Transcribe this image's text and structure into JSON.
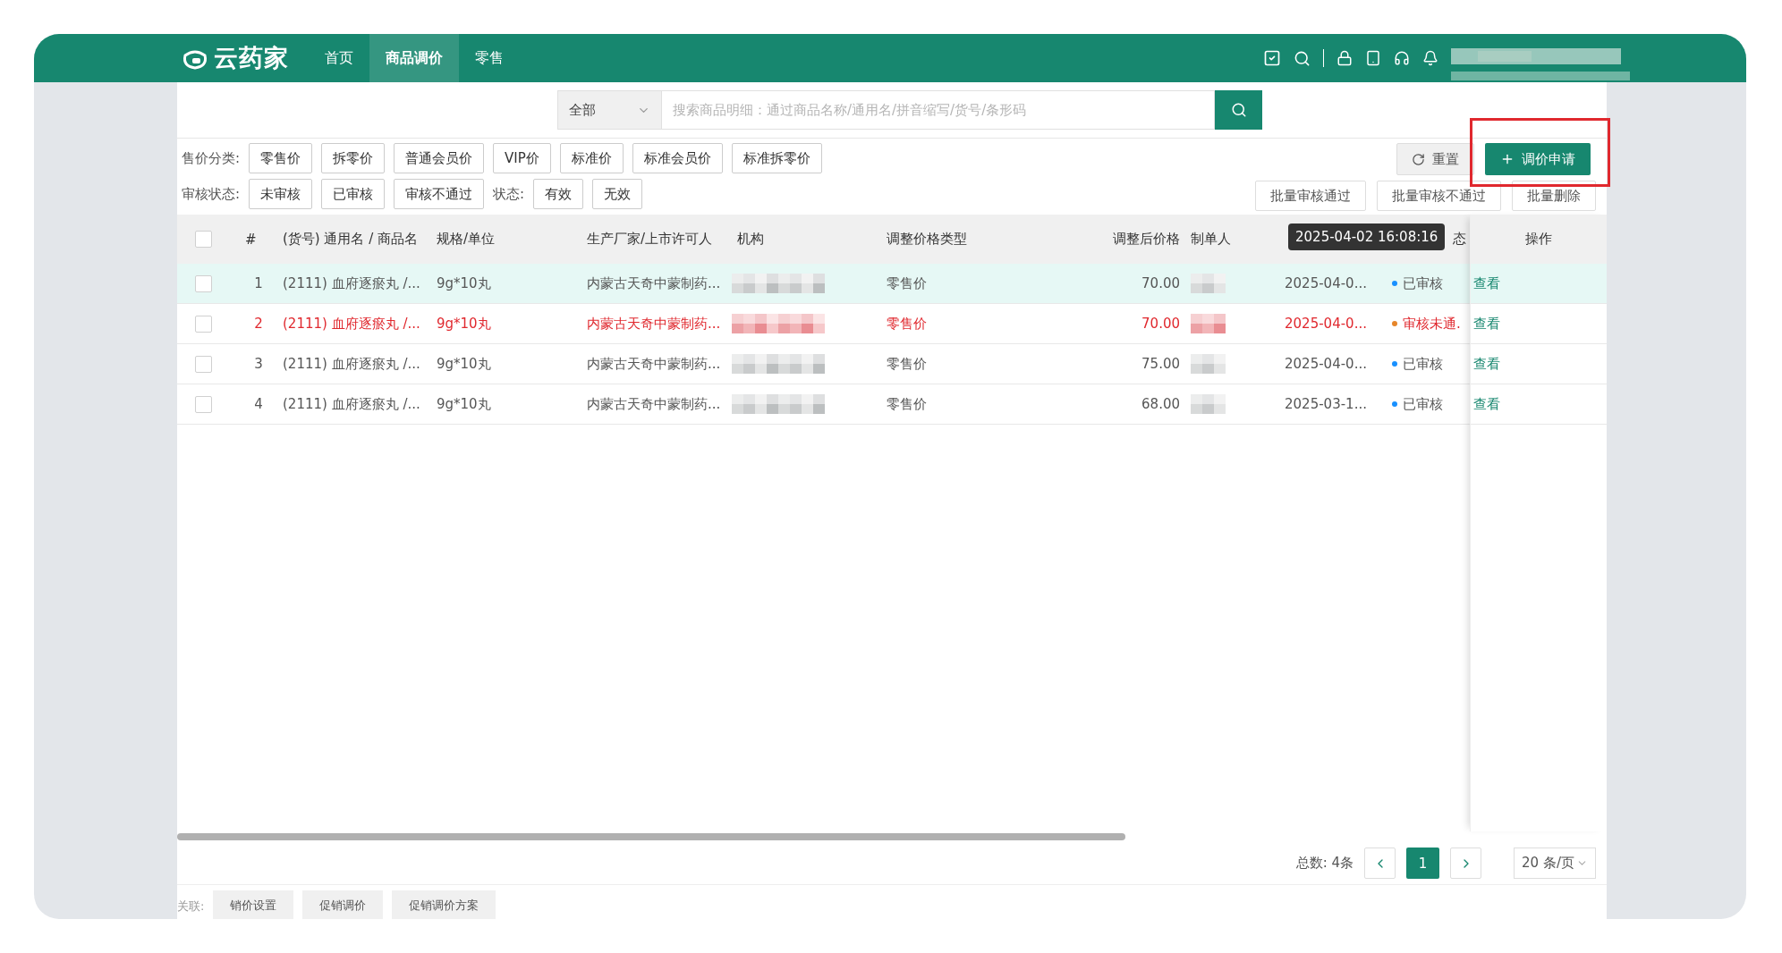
{
  "header": {
    "logo": "云药家",
    "nav": [
      {
        "label": "首页",
        "selected": false
      },
      {
        "label": "商品调价",
        "selected": true
      },
      {
        "label": "零售",
        "selected": false
      }
    ]
  },
  "search": {
    "category": "全部",
    "placeholder": "搜索商品明细：通过商品名称/通用名/拼音缩写/货号/条形码"
  },
  "filters": {
    "price_label": "售价分类:",
    "price_types": [
      "零售价",
      "拆零价",
      "普通会员价",
      "VIP价",
      "标准价",
      "标准会员价",
      "标准拆零价"
    ],
    "audit_label": "审核状态:",
    "audit_states": [
      "未审核",
      "已审核",
      "审核不通过"
    ],
    "state_label": "状态:",
    "states": [
      "有效",
      "无效"
    ]
  },
  "actions": {
    "reset": "重置",
    "apply": "调价申请",
    "apply_highlighted": true,
    "bulk": [
      "批量审核通过",
      "批量审核不通过",
      "批量删除"
    ]
  },
  "table": {
    "select_all": {
      "checked": false
    },
    "columns": [
      "#",
      "(货号) 通用名 / 商品名",
      "规格/单位",
      "生产厂家/上市许可人",
      "机构",
      "调整价格类型",
      "调整后价格",
      "制单人",
      "态",
      "操作"
    ],
    "tooltip": "2025-04-02 16:08:16",
    "rows": [
      {
        "index": "1",
        "name": "(2111) 血府逐瘀丸 /...",
        "spec": "9g*10丸",
        "mfr": "内蒙古天奇中蒙制药...",
        "type": "零售价",
        "price": "70.00",
        "date": "2025-04-0...",
        "status": "已审核",
        "kind": "approved",
        "color": "#1890ff",
        "highlighted": true,
        "checked": false,
        "action": "查看"
      },
      {
        "index": "2",
        "name": "(2111) 血府逐瘀丸 /...",
        "spec": "9g*10丸",
        "mfr": "内蒙古天奇中蒙制药...",
        "type": "零售价",
        "price": "70.00",
        "date": "2025-04-0...",
        "status": "审核未通.",
        "kind": "rejected",
        "color": "#e6862a",
        "highlighted": false,
        "checked": false,
        "action": "查看"
      },
      {
        "index": "3",
        "name": "(2111) 血府逐瘀丸 /...",
        "spec": "9g*10丸",
        "mfr": "内蒙古天奇中蒙制药...",
        "type": "零售价",
        "price": "75.00",
        "date": "2025-04-0...",
        "status": "已审核",
        "kind": "approved",
        "color": "#1890ff",
        "highlighted": false,
        "checked": false,
        "action": "查看"
      },
      {
        "index": "4",
        "name": "(2111) 血府逐瘀丸 /...",
        "spec": "9g*10丸",
        "mfr": "内蒙古天奇中蒙制药...",
        "type": "零售价",
        "price": "68.00",
        "date": "2025-03-1...",
        "status": "已审核",
        "kind": "approved",
        "color": "#1890ff",
        "highlighted": false,
        "checked": false,
        "action": "查看"
      }
    ]
  },
  "pagination": {
    "total": "总数: 4条",
    "pages": [
      {
        "label": "1",
        "selected": true
      }
    ],
    "page_size": "20 条/页"
  },
  "footer": {
    "label": "关联:",
    "tabs": [
      "销价设置",
      "促销调价",
      "促销调价方案"
    ]
  }
}
